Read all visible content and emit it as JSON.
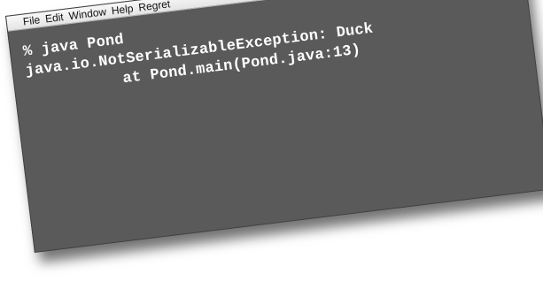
{
  "menubar": {
    "items": [
      "File",
      "Edit",
      "Window",
      "Help",
      "Regret"
    ]
  },
  "console": {
    "lines": [
      "% java Pond",
      "java.io.NotSerializableException: Duck",
      "at Pond.main(Pond.java:13)"
    ]
  },
  "colors": {
    "console_background": "#5a5a5a",
    "console_text": "#ffffff",
    "menubar_background": "#eeeeee"
  }
}
